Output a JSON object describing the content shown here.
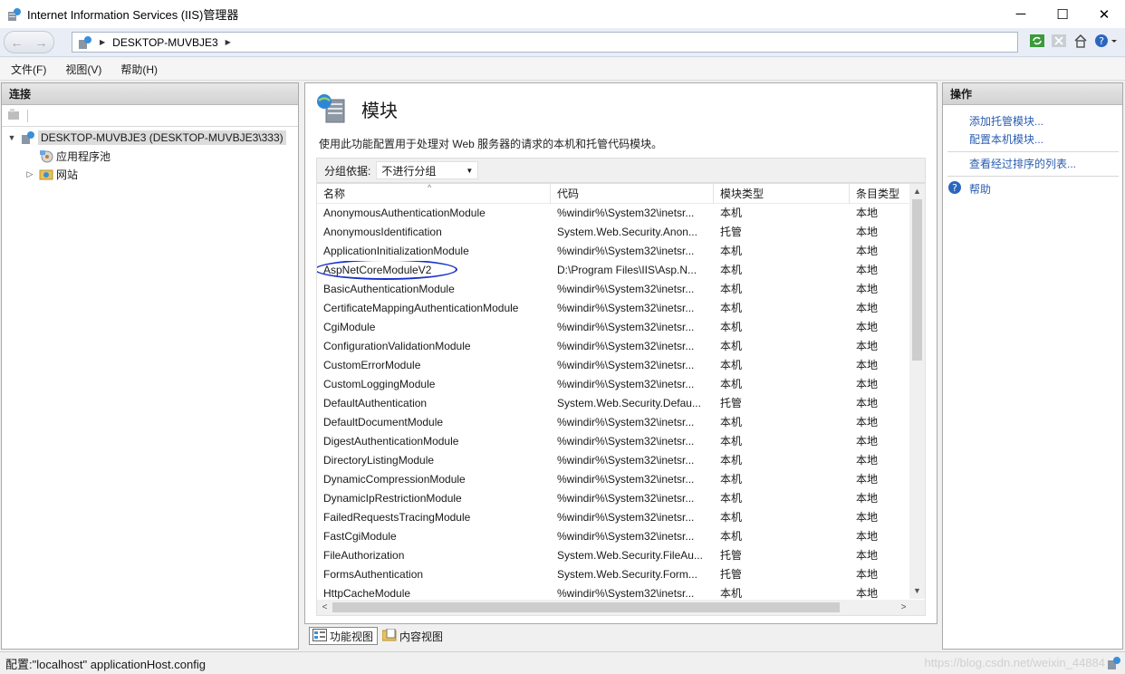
{
  "window": {
    "title": "Internet Information Services (IIS)管理器"
  },
  "address": {
    "crumb": "DESKTOP-MUVBJE3"
  },
  "menu": {
    "items": [
      "文件(F)",
      "视图(V)",
      "帮助(H)"
    ]
  },
  "connections": {
    "header": "连接",
    "server": "DESKTOP-MUVBJE3 (DESKTOP-MUVBJE3\\333)",
    "app_pools": "应用程序池",
    "sites": "网站"
  },
  "feature": {
    "title": "模块",
    "description": "使用此功能配置用于处理对 Web 服务器的请求的本机和托管代码模块。",
    "group_label": "分组依据:",
    "group_value": "不进行分组",
    "columns": [
      "名称",
      "代码",
      "模块类型",
      "条目类型"
    ],
    "rows": [
      [
        "AnonymousAuthenticationModule",
        "%windir%\\System32\\inetsr...",
        "本机",
        "本地"
      ],
      [
        "AnonymousIdentification",
        "System.Web.Security.Anon...",
        "托管",
        "本地"
      ],
      [
        "ApplicationInitializationModule",
        "%windir%\\System32\\inetsr...",
        "本机",
        "本地"
      ],
      [
        "AspNetCoreModuleV2",
        "D:\\Program Files\\IIS\\Asp.N...",
        "本机",
        "本地"
      ],
      [
        "BasicAuthenticationModule",
        "%windir%\\System32\\inetsr...",
        "本机",
        "本地"
      ],
      [
        "CertificateMappingAuthenticationModule",
        "%windir%\\System32\\inetsr...",
        "本机",
        "本地"
      ],
      [
        "CgiModule",
        "%windir%\\System32\\inetsr...",
        "本机",
        "本地"
      ],
      [
        "ConfigurationValidationModule",
        "%windir%\\System32\\inetsr...",
        "本机",
        "本地"
      ],
      [
        "CustomErrorModule",
        "%windir%\\System32\\inetsr...",
        "本机",
        "本地"
      ],
      [
        "CustomLoggingModule",
        "%windir%\\System32\\inetsr...",
        "本机",
        "本地"
      ],
      [
        "DefaultAuthentication",
        "System.Web.Security.Defau...",
        "托管",
        "本地"
      ],
      [
        "DefaultDocumentModule",
        "%windir%\\System32\\inetsr...",
        "本机",
        "本地"
      ],
      [
        "DigestAuthenticationModule",
        "%windir%\\System32\\inetsr...",
        "本机",
        "本地"
      ],
      [
        "DirectoryListingModule",
        "%windir%\\System32\\inetsr...",
        "本机",
        "本地"
      ],
      [
        "DynamicCompressionModule",
        "%windir%\\System32\\inetsr...",
        "本机",
        "本地"
      ],
      [
        "DynamicIpRestrictionModule",
        "%windir%\\System32\\inetsr...",
        "本机",
        "本地"
      ],
      [
        "FailedRequestsTracingModule",
        "%windir%\\System32\\inetsr...",
        "本机",
        "本地"
      ],
      [
        "FastCgiModule",
        "%windir%\\System32\\inetsr...",
        "本机",
        "本地"
      ],
      [
        "FileAuthorization",
        "System.Web.Security.FileAu...",
        "托管",
        "本地"
      ],
      [
        "FormsAuthentication",
        "System.Web.Security.Form...",
        "托管",
        "本地"
      ],
      [
        "HttpCacheModule",
        "%windir%\\System32\\inetsr...",
        "本机",
        "本地"
      ]
    ]
  },
  "view_tabs": {
    "features": "功能视图",
    "content": "内容视图"
  },
  "actions": {
    "header": "操作",
    "add_managed": "添加托管模块...",
    "configure_native": "配置本机模块...",
    "view_ordered": "查看经过排序的列表...",
    "help": "帮助"
  },
  "status": {
    "text": "配置:\"localhost\" applicationHost.config",
    "watermark": "https://blog.csdn.net/weixin_44884"
  }
}
